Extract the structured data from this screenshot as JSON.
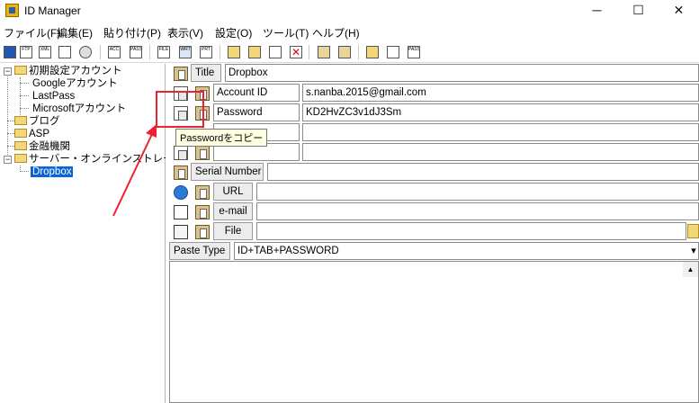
{
  "window": {
    "title": "ID Manager",
    "minimize_glyph": "─",
    "maximize_glyph": "☐",
    "close_glyph": "✕"
  },
  "menu": [
    "ファイル(F)",
    "編集(E)",
    "貼り付け(P)",
    "表示(V)",
    "設定(O)",
    "ツール(T)",
    "ヘルプ(H)"
  ],
  "toolbar": {
    "labels": [
      "",
      "FTP",
      "XML",
      "",
      "",
      "ACC",
      "PASS",
      "FILE",
      "WRT",
      "PRT",
      "",
      "",
      "",
      "",
      "",
      "",
      "",
      "",
      "PASS"
    ]
  },
  "tree": {
    "items": [
      {
        "label": "初期設定アカウント",
        "expanded": true
      },
      {
        "label": "Googleアカウント"
      },
      {
        "label": "LastPass"
      },
      {
        "label": "Microsoftアカウント"
      },
      {
        "label": "ブログ"
      },
      {
        "label": "ASP"
      },
      {
        "label": "金融機関"
      },
      {
        "label": "サーバー・オンラインストレージ",
        "expanded": true
      },
      {
        "label": "Dropbox",
        "selected": true
      }
    ],
    "expander_open": "−"
  },
  "form": {
    "title_label": "Title",
    "title_value": "Dropbox",
    "account_id_label": "Account ID",
    "account_id_value": "s.nanba.2015@gmail.com",
    "password_label": "Password",
    "password_value": "KD2HvZC3v1dJ3Sm",
    "serial_number_label": "Serial Number",
    "url_label": "URL",
    "email_label": "e-mail",
    "file_label": "File",
    "paste_type_label": "Paste Type",
    "paste_type_value": "ID+TAB+PASSWORD",
    "tooltip": "Passwordをコピー",
    "dropdown_glyph": "▾",
    "scroll_up_glyph": "▲"
  },
  "colors": {
    "selection": "#0a64d8",
    "annotation": "#ee2233",
    "tooltip_bg": "#ffffe1"
  }
}
